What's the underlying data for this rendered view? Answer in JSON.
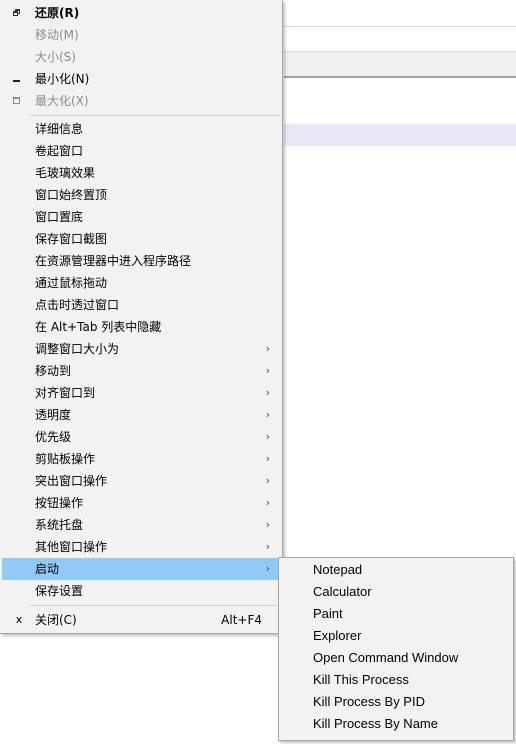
{
  "menu": {
    "items": [
      {
        "label": "还原(R)",
        "icon": "restore-icon",
        "state": "bold"
      },
      {
        "label": "移动(M)",
        "state": "disabled"
      },
      {
        "label": "大小(S)",
        "state": "disabled"
      },
      {
        "label": "最小化(N)",
        "icon": "minimize-icon"
      },
      {
        "label": "最大化(X)",
        "icon": "maximize-icon",
        "state": "disabled"
      },
      {
        "label": "详细信息"
      },
      {
        "label": "卷起窗口"
      },
      {
        "label": "毛玻璃效果"
      },
      {
        "label": "窗口始终置顶"
      },
      {
        "label": "窗口置底"
      },
      {
        "label": "保存窗口截图"
      },
      {
        "label": "在资源管理器中进入程序路径"
      },
      {
        "label": "通过鼠标拖动"
      },
      {
        "label": "点击时透过窗口"
      },
      {
        "label": "在 Alt+Tab 列表中隐藏"
      },
      {
        "label": "调整窗口大小为",
        "submenu": true
      },
      {
        "label": "移动到",
        "submenu": true
      },
      {
        "label": "对齐窗口到",
        "submenu": true
      },
      {
        "label": "透明度",
        "submenu": true
      },
      {
        "label": "优先级",
        "submenu": true
      },
      {
        "label": "剪贴板操作",
        "submenu": true
      },
      {
        "label": "突出窗口操作",
        "submenu": true
      },
      {
        "label": "按钮操作",
        "submenu": true
      },
      {
        "label": "系统托盘",
        "submenu": true
      },
      {
        "label": "其他窗口操作",
        "submenu": true
      },
      {
        "label": "启动",
        "submenu": true,
        "state": "highlighted"
      },
      {
        "label": "保存设置"
      },
      {
        "label": "关闭(C)",
        "icon": "close-icon",
        "icon_glyph": "x",
        "shortcut": "Alt+F4"
      }
    ],
    "arrow_glyph": "›"
  },
  "submenu": {
    "items": [
      {
        "label": "Notepad"
      },
      {
        "label": "Calculator"
      },
      {
        "label": "Paint"
      },
      {
        "label": "Explorer"
      },
      {
        "label": "Open Command Window"
      },
      {
        "label": "Kill This Process"
      },
      {
        "label": "Kill Process By PID"
      },
      {
        "label": "Kill Process By Name"
      }
    ]
  },
  "colors": {
    "menu_bg": "#f2f2f2",
    "highlight": "#91c9f7",
    "disabled_text": "#8c8c8c"
  }
}
